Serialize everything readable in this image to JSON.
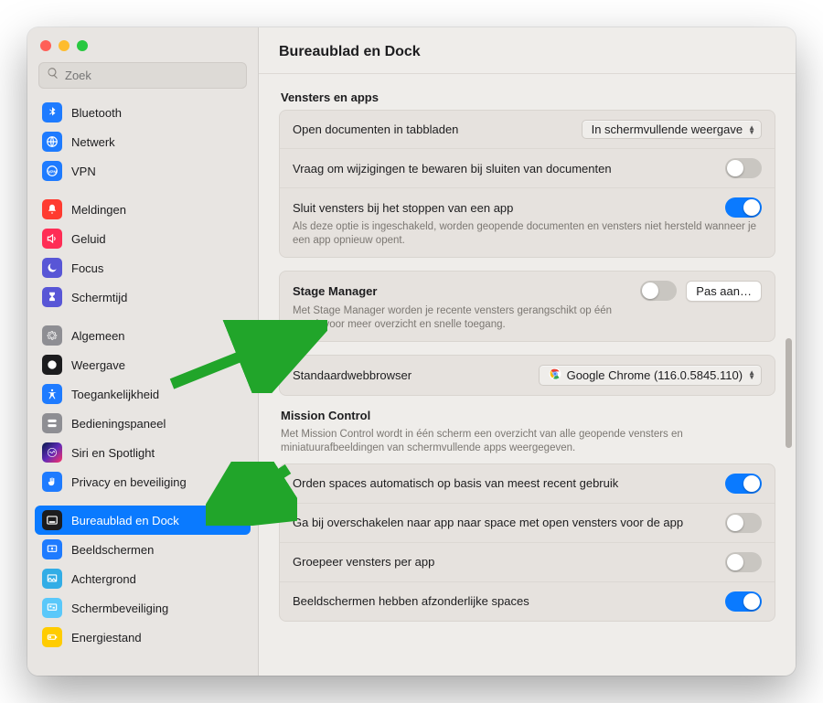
{
  "window": {
    "title": "Bureaublad en Dock"
  },
  "search": {
    "placeholder": "Zoek"
  },
  "sidebar": {
    "items": [
      {
        "label": "Bluetooth",
        "icon": "bluetooth-icon",
        "color": "bg-blue"
      },
      {
        "label": "Netwerk",
        "icon": "globe-icon",
        "color": "bg-blue"
      },
      {
        "label": "VPN",
        "icon": "vpn-icon",
        "color": "bg-blue"
      },
      {
        "label": "Meldingen",
        "icon": "bell-icon",
        "color": "bg-red"
      },
      {
        "label": "Geluid",
        "icon": "speaker-icon",
        "color": "bg-pink"
      },
      {
        "label": "Focus",
        "icon": "moon-icon",
        "color": "bg-purple"
      },
      {
        "label": "Schermtijd",
        "icon": "hourglass-icon",
        "color": "bg-purple"
      },
      {
        "label": "Algemeen",
        "icon": "gear-icon",
        "color": "bg-gray"
      },
      {
        "label": "Weergave",
        "icon": "appearance-icon",
        "color": "bg-black"
      },
      {
        "label": "Toegankelijkheid",
        "icon": "accessibility-icon",
        "color": "bg-blue"
      },
      {
        "label": "Bedieningspaneel",
        "icon": "controlcenter-icon",
        "color": "bg-gray"
      },
      {
        "label": "Siri en Spotlight",
        "icon": "siri-icon",
        "color": "bg-siri"
      },
      {
        "label": "Privacy en beveiliging",
        "icon": "hand-icon",
        "color": "bg-blue"
      },
      {
        "label": "Bureaublad en Dock",
        "icon": "dock-icon",
        "color": "bg-black",
        "selected": true
      },
      {
        "label": "Beeldschermen",
        "icon": "displays-icon",
        "color": "bg-blue"
      },
      {
        "label": "Achtergrond",
        "icon": "wallpaper-icon",
        "color": "bg-cyan"
      },
      {
        "label": "Schermbeveiliging",
        "icon": "screensaver-icon",
        "color": "bg-teal"
      },
      {
        "label": "Energiestand",
        "icon": "battery-icon",
        "color": "bg-yellow"
      }
    ],
    "gaps_after": [
      2,
      6,
      12
    ]
  },
  "sections": {
    "windows_apps": {
      "title": "Vensters en apps",
      "open_docs_label": "Open documenten in tabbladen",
      "open_docs_value": "In schermvullende weergave",
      "ask_save_label": "Vraag om wijzigingen te bewaren bij sluiten van documenten",
      "ask_save_on": false,
      "close_windows_label": "Sluit vensters bij het stoppen van een app",
      "close_windows_sub": "Als deze optie is ingeschakeld, worden geopende documenten en vensters niet hersteld wanneer je een app opnieuw opent.",
      "close_windows_on": true
    },
    "stage_manager": {
      "label": "Stage Manager",
      "sub": "Met Stage Manager worden je recente vensters gerangschikt op één strook voor meer overzicht en snelle toegang.",
      "on": false,
      "button": "Pas aan…"
    },
    "default_browser": {
      "label": "Standaardwebbrowser",
      "value": "Google Chrome (116.0.5845.110)"
    },
    "mission_control": {
      "title": "Mission Control",
      "desc": "Met Mission Control wordt in één scherm een overzicht van alle geopende vensters en miniatuurafbeeldingen van schermvullende apps weergegeven.",
      "auto_rearrange_label": "Orden spaces automatisch op basis van meest recent gebruik",
      "auto_rearrange_on": true,
      "switch_space_label": "Ga bij overschakelen naar app naar space met open vensters voor de app",
      "switch_space_on": false,
      "group_label": "Groepeer vensters per app",
      "group_on": false,
      "separate_spaces_label": "Beeldschermen hebben afzonderlijke spaces",
      "separate_spaces_on": true
    }
  }
}
